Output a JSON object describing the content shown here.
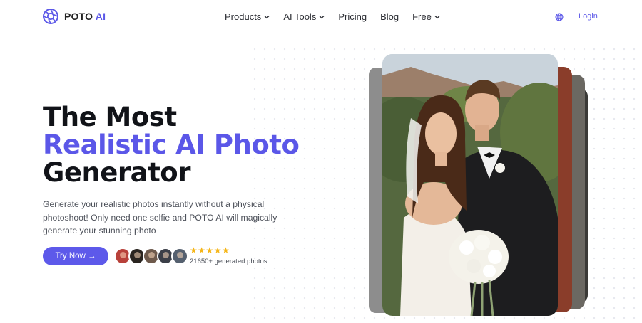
{
  "nav": {
    "brand": "POTO",
    "brand_accent": "AI",
    "links": [
      {
        "label": "Products",
        "dropdown": true
      },
      {
        "label": "AI Tools",
        "dropdown": true
      },
      {
        "label": "Pricing",
        "dropdown": false
      },
      {
        "label": "Blog",
        "dropdown": false
      },
      {
        "label": "Free",
        "dropdown": true
      }
    ],
    "language_icon": "globe-icon",
    "login_label": "Login"
  },
  "hero": {
    "title_line1": "The Most",
    "title_line2": "Realistic AI Photo",
    "title_line3": "Generator",
    "description": "Generate your realistic photos instantly without a physical photoshoot! Only need one selfie and POTO AI will magically generate your stunning photo",
    "cta_label": "Try Now →",
    "rating_stars": "★★★★★",
    "rating_value": 5,
    "generated_count": "21650+ generated photos"
  },
  "colors": {
    "accent": "#5b57e8",
    "star": "#f5b619",
    "text": "#111318"
  }
}
